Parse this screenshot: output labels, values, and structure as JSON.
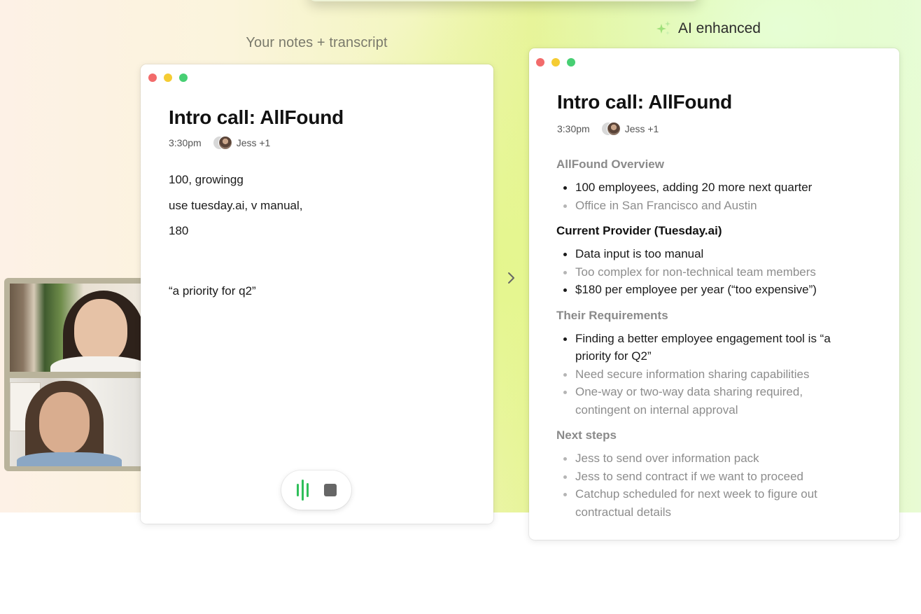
{
  "captions": {
    "left": "Your notes + transcript",
    "right": "AI enhanced"
  },
  "icons": {
    "sparkle": "sparkle-icon",
    "waveform": "waveform-icon",
    "stop": "stop-icon",
    "chevron": "chevron-right-icon"
  },
  "colors": {
    "accent_green": "#2fbf5a",
    "traffic_red": "#f26b6b",
    "traffic_yellow": "#f5cc33",
    "traffic_green": "#47cf73"
  },
  "notes_window": {
    "title": "Intro call: AllFound",
    "time": "3:30pm",
    "attendees": "Jess +1",
    "lines": [
      "100, growingg",
      "use tuesday.ai, v manual,",
      "180"
    ],
    "quote": "“a priority for q2”"
  },
  "enhanced_window": {
    "title": "Intro call: AllFound",
    "time": "3:30pm",
    "attendees": "Jess +1",
    "sections": [
      {
        "heading": "AllFound Overview",
        "items": [
          "100 employees, adding 20 more next quarter",
          "Office in San Francisco and Austin"
        ]
      },
      {
        "heading": "Current Provider (Tuesday.ai)",
        "items": [
          "Data input is too manual",
          "Too complex for non-technical team members",
          "$180 per employee per year (“too expensive”)"
        ]
      },
      {
        "heading": "Their Requirements",
        "items": [
          "Finding a better employee engagement tool is “a priority for Q2”",
          "Need secure information sharing capabilities",
          "One-way or two-way data sharing required, contingent on internal approval"
        ]
      },
      {
        "heading": "Next steps",
        "items": [
          "Jess to send over information pack",
          "Jess to send contract if we want to proceed",
          "Catchup scheduled for next week to figure out contractual details"
        ]
      }
    ]
  }
}
